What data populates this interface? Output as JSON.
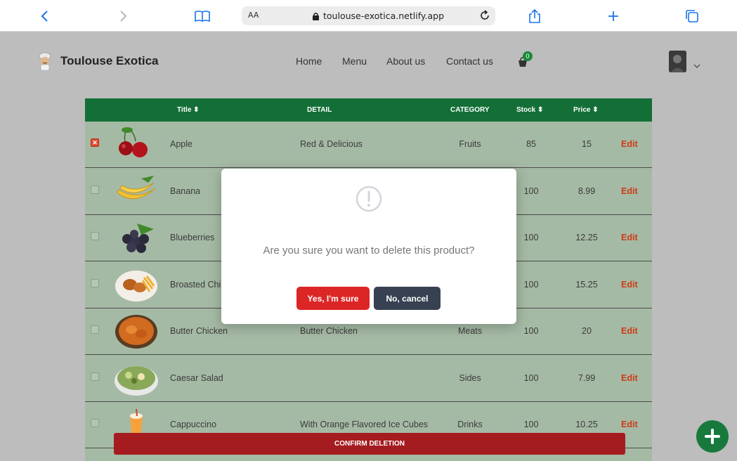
{
  "browser": {
    "text_size_label": "AA",
    "url": "toulouse-exotica.netlify.app",
    "icons": [
      "back-icon",
      "forward-icon",
      "book-icon",
      "lock-icon",
      "reload-icon",
      "share-icon",
      "plus-icon",
      "tabs-icon"
    ]
  },
  "header": {
    "brand": "Toulouse Exotica",
    "nav": [
      "Home",
      "Menu",
      "About us",
      "Contact us"
    ],
    "cart_count": "0"
  },
  "table": {
    "columns": {
      "title": "Title ⬍",
      "detail": "DETAIL",
      "category": "CATEGORY",
      "stock": "Stock ⬍",
      "price": "Price ⬍"
    },
    "edit_label": "Edit",
    "rows": [
      {
        "title": "Apple",
        "detail": "Red & Delicious",
        "category": "Fruits",
        "stock": "85",
        "price": "15",
        "checked": true,
        "thumb": "cherries"
      },
      {
        "title": "Banana",
        "detail": "",
        "category": "",
        "stock": "100",
        "price": "8.99",
        "checked": false,
        "thumb": "banana"
      },
      {
        "title": "Blueberries",
        "detail": "",
        "category": "",
        "stock": "100",
        "price": "12.25",
        "checked": false,
        "thumb": "blueberries"
      },
      {
        "title": "Broasted Chi",
        "detail": "",
        "category": "",
        "stock": "100",
        "price": "15.25",
        "checked": false,
        "thumb": "fried-chicken"
      },
      {
        "title": "Butter Chicken",
        "detail": "Butter Chicken",
        "category": "Meats",
        "stock": "100",
        "price": "20",
        "checked": false,
        "thumb": "butter-chicken"
      },
      {
        "title": "Caesar Salad",
        "detail": "",
        "category": "Sides",
        "stock": "100",
        "price": "7.99",
        "checked": false,
        "thumb": "salad"
      },
      {
        "title": "Cappuccino",
        "detail": "With Orange Flavored Ice Cubes",
        "category": "Drinks",
        "stock": "100",
        "price": "10.25",
        "checked": false,
        "thumb": "drink"
      }
    ]
  },
  "confirm_bar": "CONFIRM DELETION",
  "modal": {
    "message": "Are you sure you want to delete this product?",
    "yes_label": "Yes, I'm sure",
    "no_label": "No, cancel"
  },
  "colors": {
    "header_green": "#136f36",
    "row_bg": "#a5baa5",
    "edit_red": "#cc3b17",
    "danger": "#dc2626",
    "neutral_dark": "#374151"
  }
}
